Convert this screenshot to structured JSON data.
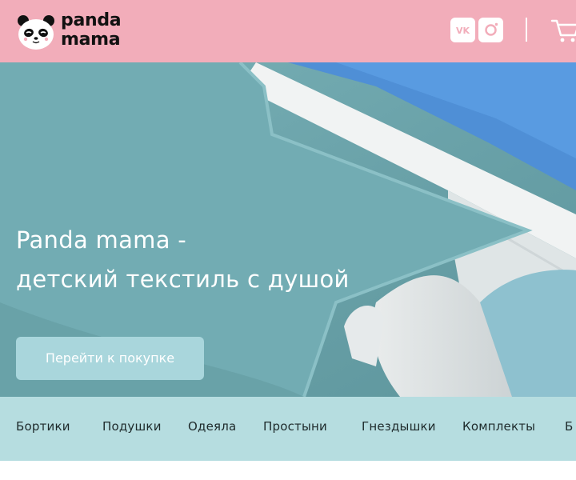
{
  "header": {
    "logo": {
      "line1": "panda",
      "line2": "mama"
    },
    "social": [
      {
        "name": "vk",
        "label": "VK",
        "icon": "vk-icon"
      },
      {
        "name": "instagram",
        "icon": "instagram-icon"
      }
    ],
    "cart_icon": "cart-icon"
  },
  "hero": {
    "title_line1": "Panda mama -",
    "title_line2": "детский текстиль с душой",
    "cta_label": "Перейти к покупке"
  },
  "categories": [
    "Бортики",
    "Подушки",
    "Одеяла",
    "Простыни",
    "Гнездышки",
    "Комплекты",
    "Б"
  ],
  "colors": {
    "header_bg": "#f2adba",
    "nav_bg": "#b6dde0",
    "cta_bg": "#a9d6dc",
    "hero_fabric": "#6fa7ae"
  }
}
